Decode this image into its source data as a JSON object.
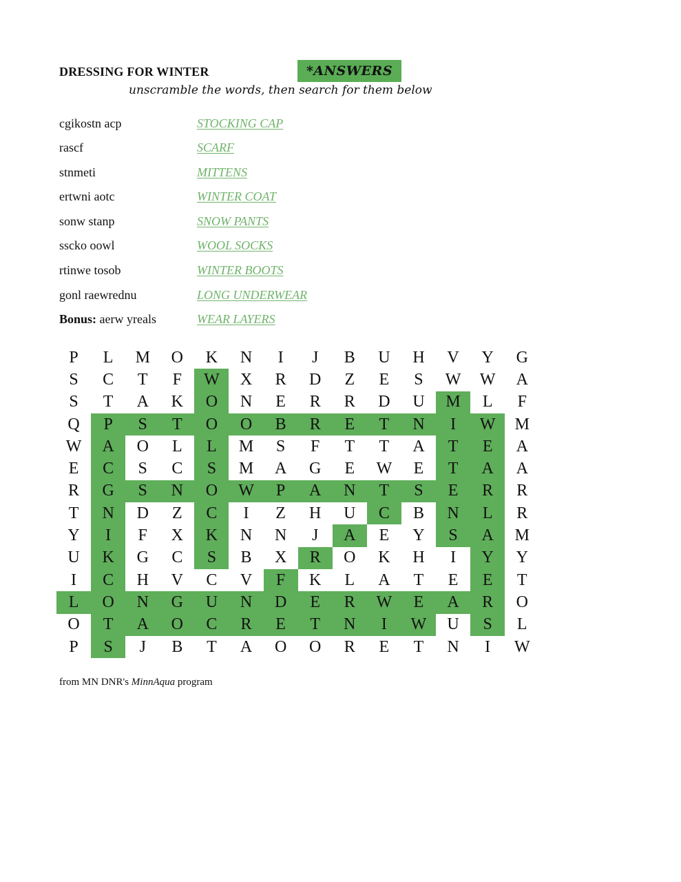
{
  "header": {
    "title": "DRESSING FOR WINTER",
    "badge": "*ANSWERS",
    "subtitle": "unscramble the words, then search for them below"
  },
  "colors": {
    "highlight": "#5fae5a",
    "answer_text": "#6fb36a"
  },
  "clues": [
    {
      "prefix": "",
      "scrambled": "cgikostn acp",
      "answer": "STOCKING CAP"
    },
    {
      "prefix": "",
      "scrambled": "rascf",
      "answer": "SCARF"
    },
    {
      "prefix": "",
      "scrambled": "stnmeti",
      "answer": "MITTENS"
    },
    {
      "prefix": "",
      "scrambled": "ertwni aotc",
      "answer": "WINTER COAT"
    },
    {
      "prefix": "",
      "scrambled": "sonw stanp",
      "answer": "SNOW PANTS"
    },
    {
      "prefix": "",
      "scrambled": "sscko oowl",
      "answer": "WOOL SOCKS"
    },
    {
      "prefix": "",
      "scrambled": "rtinwe tosob",
      "answer": "WINTER BOOTS"
    },
    {
      "prefix": "",
      "scrambled": "gonl raewrednu",
      "answer": "LONG UNDERWEAR"
    },
    {
      "prefix": "Bonus:",
      "scrambled": "aerw yreals",
      "answer": "WEAR LAYERS"
    }
  ],
  "grid": {
    "rows": [
      "PLMOKNIJBUHVYG",
      "SCTFWXRDZESWWA",
      "STAKONERRDUMLF",
      "QPSTOOBRETNIWM",
      "WAOLLMSFTTATEA",
      "ECSCSMAGEWETAA",
      "RGSNOWPANTSERR",
      "TNDZCIZHUCBNLR",
      "YIFXKNNJAEYSAM",
      "UKGCSBXROKHIYY",
      "ICHVCVFKLATEET",
      "LONGUNDERWEARO",
      "OTAOCRETNIWUSL",
      "PSJBTAOORETNIW"
    ],
    "highlighted": [
      "00000000000000",
      "00001000000000",
      "00001000000100",
      "01111111111110",
      "01001000000110",
      "01001000000110",
      "01111111111110",
      "01001000010110",
      "01001000100110",
      "01001001000010",
      "01000010000010",
      "11111111111110",
      "01111111111010",
      "01000000000000"
    ]
  },
  "footer": {
    "prefix": "from MN DNR's ",
    "program": "MinnAqua",
    "suffix": " program"
  }
}
